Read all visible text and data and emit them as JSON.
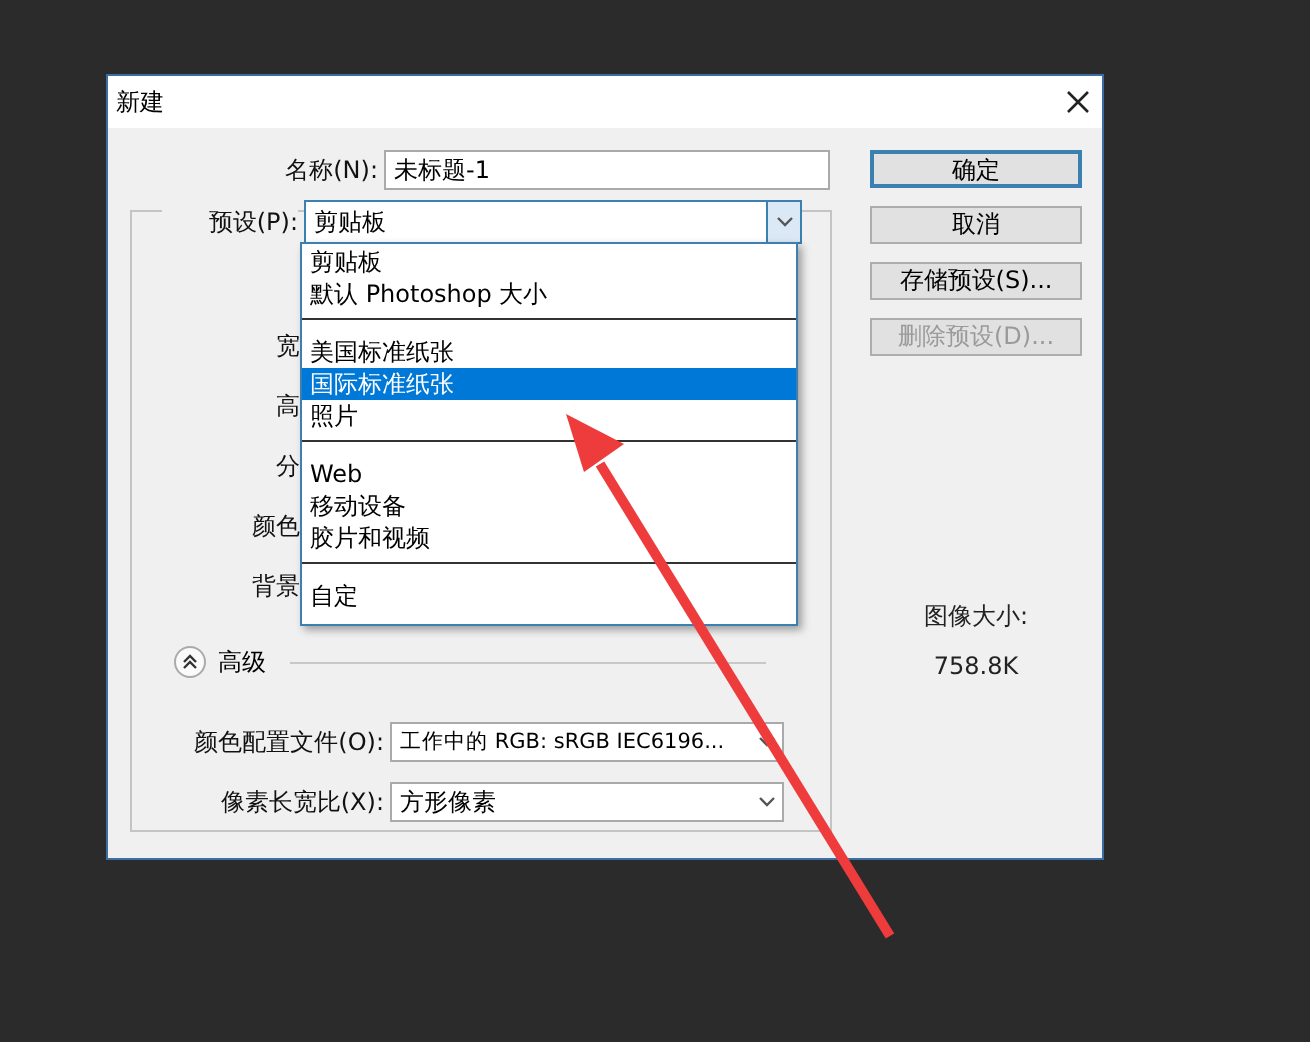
{
  "window": {
    "title": "新建"
  },
  "name_field": {
    "label": "名称(N):",
    "value": "未标题-1"
  },
  "preset": {
    "label": "预设(P):",
    "value": "剪贴板",
    "open": true
  },
  "preset_menu": {
    "groups": [
      [
        {
          "label": "剪贴板",
          "selected": false
        },
        {
          "label": "默认 Photoshop 大小",
          "selected": false
        }
      ],
      [
        {
          "label": "美国标准纸张",
          "selected": false
        },
        {
          "label": "国际标准纸张",
          "selected": true
        },
        {
          "label": "照片",
          "selected": false
        }
      ],
      [
        {
          "label": "Web",
          "selected": false
        },
        {
          "label": "移动设备",
          "selected": false
        },
        {
          "label": "胶片和视频",
          "selected": false
        }
      ],
      [
        {
          "label": "自定",
          "selected": false
        }
      ]
    ]
  },
  "covered_labels": [
    "宽",
    "高",
    "分",
    "颜色",
    "背景"
  ],
  "advanced": {
    "label": "高级",
    "expanded": true
  },
  "color_profile": {
    "label": "颜色配置文件(O):",
    "value": "工作中的 RGB: sRGB IEC6196..."
  },
  "pixel_aspect": {
    "label": "像素长宽比(X):",
    "value": "方形像素"
  },
  "buttons": [
    {
      "label": "确定",
      "default": true,
      "disabled": false
    },
    {
      "label": "取消",
      "default": false,
      "disabled": false
    },
    {
      "label": "存储预设(S)...",
      "default": false,
      "disabled": false
    },
    {
      "label": "删除预设(D)...",
      "default": false,
      "disabled": true
    }
  ],
  "image_size": {
    "label": "图像大小:",
    "value": "758.8K"
  }
}
